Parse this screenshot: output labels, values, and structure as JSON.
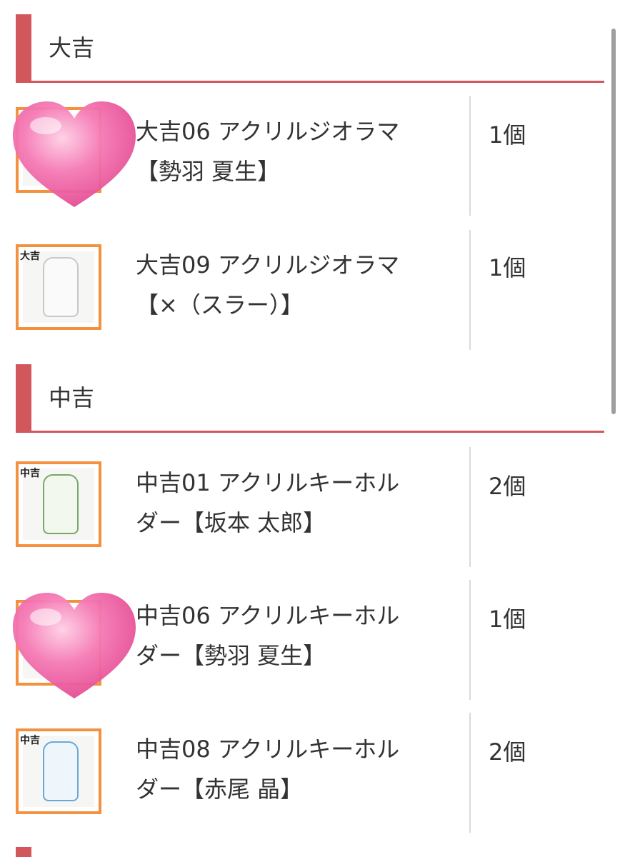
{
  "sections": [
    {
      "title": "大吉",
      "items": [
        {
          "name_line1": "大吉06 アクリルジオラマ",
          "name_line2": "【勢羽 夏生】",
          "qty": "1個",
          "thumb": "heart-sticker"
        },
        {
          "name_line1": "大吉09 アクリルジオラマ",
          "name_line2": "【×（スラー）】",
          "qty": "1個",
          "thumb": "product",
          "tag": "大吉"
        }
      ]
    },
    {
      "title": "中吉",
      "items": [
        {
          "name_line1": "中吉01 アクリルキーホル",
          "name_line2": "ダー【坂本 太郎】",
          "qty": "2個",
          "thumb": "product",
          "tag": "中吉"
        },
        {
          "name_line1": "中吉06 アクリルキーホル",
          "name_line2": "ダー【勢羽 夏生】",
          "qty": "1個",
          "thumb": "heart-sticker"
        },
        {
          "name_line1": "中吉08 アクリルキーホル",
          "name_line2": "ダー【赤尾 晶】",
          "qty": "2個",
          "thumb": "product",
          "tag": "中吉"
        }
      ]
    }
  ],
  "colors": {
    "accent": "#d1575d",
    "thumb_border": "#f3913f",
    "heart": "#f06aa6"
  }
}
